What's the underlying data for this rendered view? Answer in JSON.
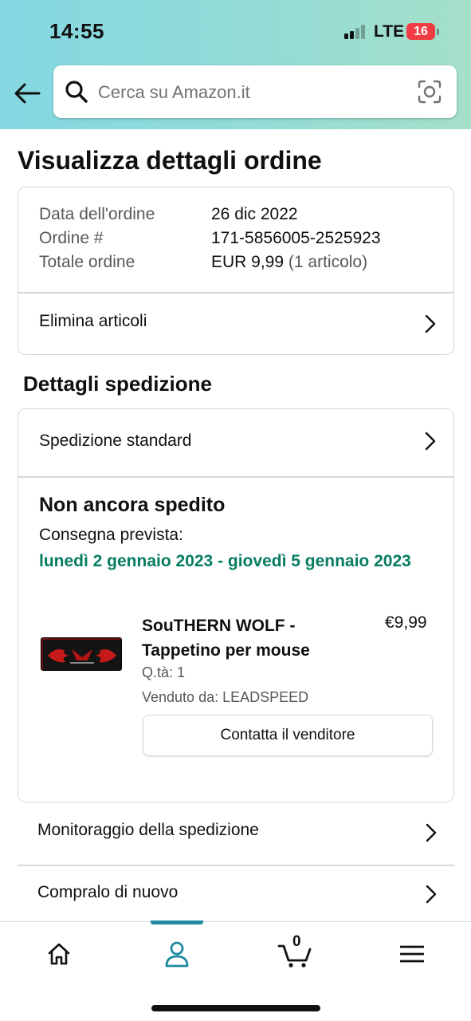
{
  "status_bar": {
    "time": "14:55",
    "network": "LTE",
    "battery": "16",
    "battery_color": "#f23c43"
  },
  "header": {
    "back_icon": "arrow-left-icon",
    "search_placeholder": "Cerca su Amazon.it",
    "search_icon": "magnifier-icon",
    "camera_icon": "camera-scan-icon"
  },
  "page": {
    "title": "Visualizza dettagli ordine"
  },
  "order_summary": {
    "rows": [
      {
        "label": "Data dell'ordine",
        "value": "26 dic 2022"
      },
      {
        "label": "Ordine #",
        "value": "171-5856005-2525923"
      },
      {
        "label": "Totale ordine",
        "value": "EUR 9,99",
        "extra": "(1 articolo)"
      }
    ],
    "delete_items_label": "Elimina articoli"
  },
  "shipping": {
    "section_title": "Dettagli spedizione",
    "method_label": "Spedizione standard",
    "status": "Non ancora spedito",
    "delivery_label": "Consegna prevista:",
    "delivery_dates": "lunedì 2 gennaio 2023 - giovedì 5 gennaio 2023",
    "delivery_color": "#067d62",
    "item": {
      "name": "SouTHERN WOLF - Tappetino per mouse",
      "price": "€9,99",
      "quantity": "Q.tà: 1",
      "seller": "Venduto da: LEADSPEED",
      "contact_button": "Contatta il venditore"
    }
  },
  "actions": [
    {
      "label": "Monitoraggio della spedizione"
    },
    {
      "label": "Compralo di nuovo"
    }
  ],
  "bottom_nav": {
    "items": [
      "home-icon",
      "account-icon",
      "cart-icon",
      "menu-icon"
    ],
    "active": "account-icon",
    "active_color": "#1f8a9e",
    "cart_count": "0"
  }
}
